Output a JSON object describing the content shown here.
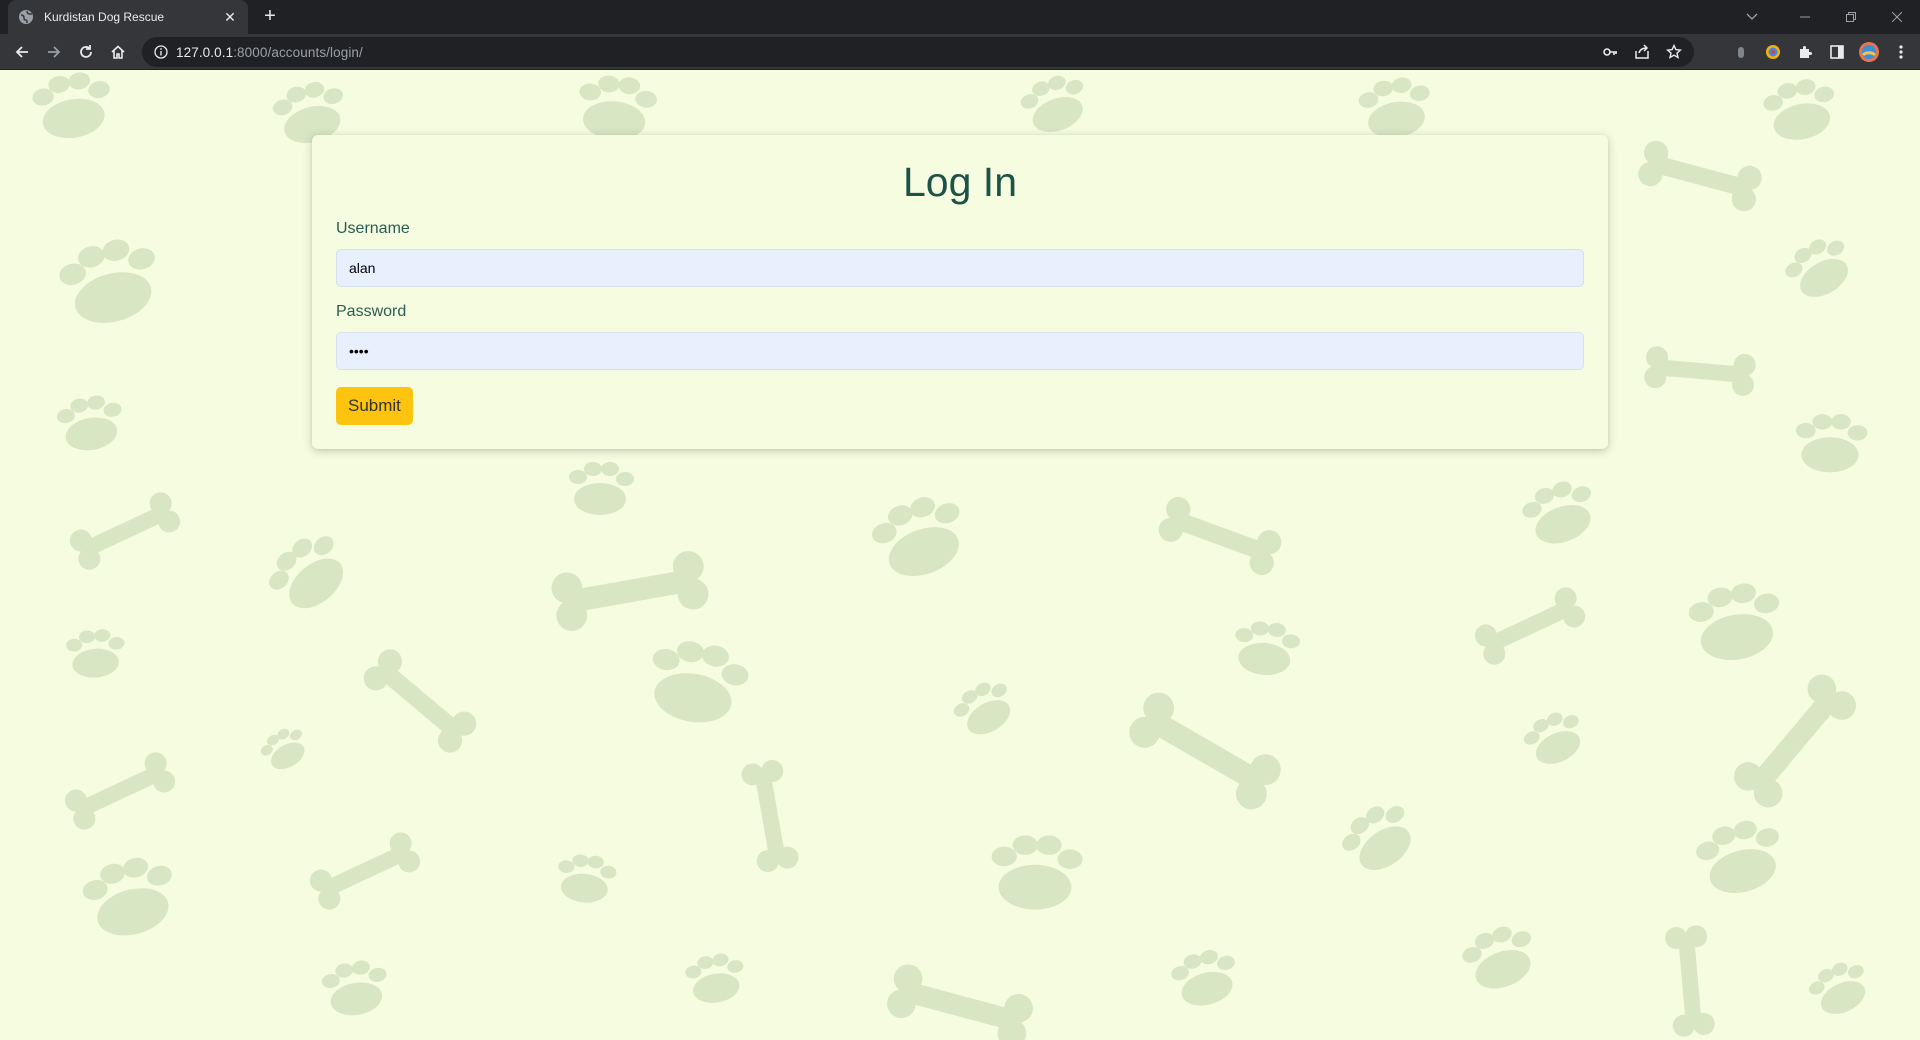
{
  "browser": {
    "tab_title": "Kurdistan Dog Rescue",
    "tab_close": "✕",
    "new_tab": "+",
    "url_host": "127.0.0.1",
    "url_path": ":8000/accounts/login/",
    "icons": [
      "back-arrow-icon",
      "forward-arrow-icon",
      "reload-icon",
      "home-icon",
      "site-info-icon",
      "key-icon",
      "share-icon",
      "star-icon",
      "extension-icon",
      "puzzle-icon",
      "sidepanel-icon",
      "profile-avatar-icon",
      "kebab-menu-icon"
    ]
  },
  "login": {
    "title": "Log In",
    "username_label": "Username",
    "username_value": "alan",
    "password_label": "Password",
    "password_value": "••••",
    "submit_label": "Submit"
  },
  "colors": {
    "background": "#f6fcdf",
    "paw_pattern": "#d8e6c4",
    "title": "#1d5248",
    "input_bg": "#e8f0fe",
    "submit": "#fcc30f"
  }
}
